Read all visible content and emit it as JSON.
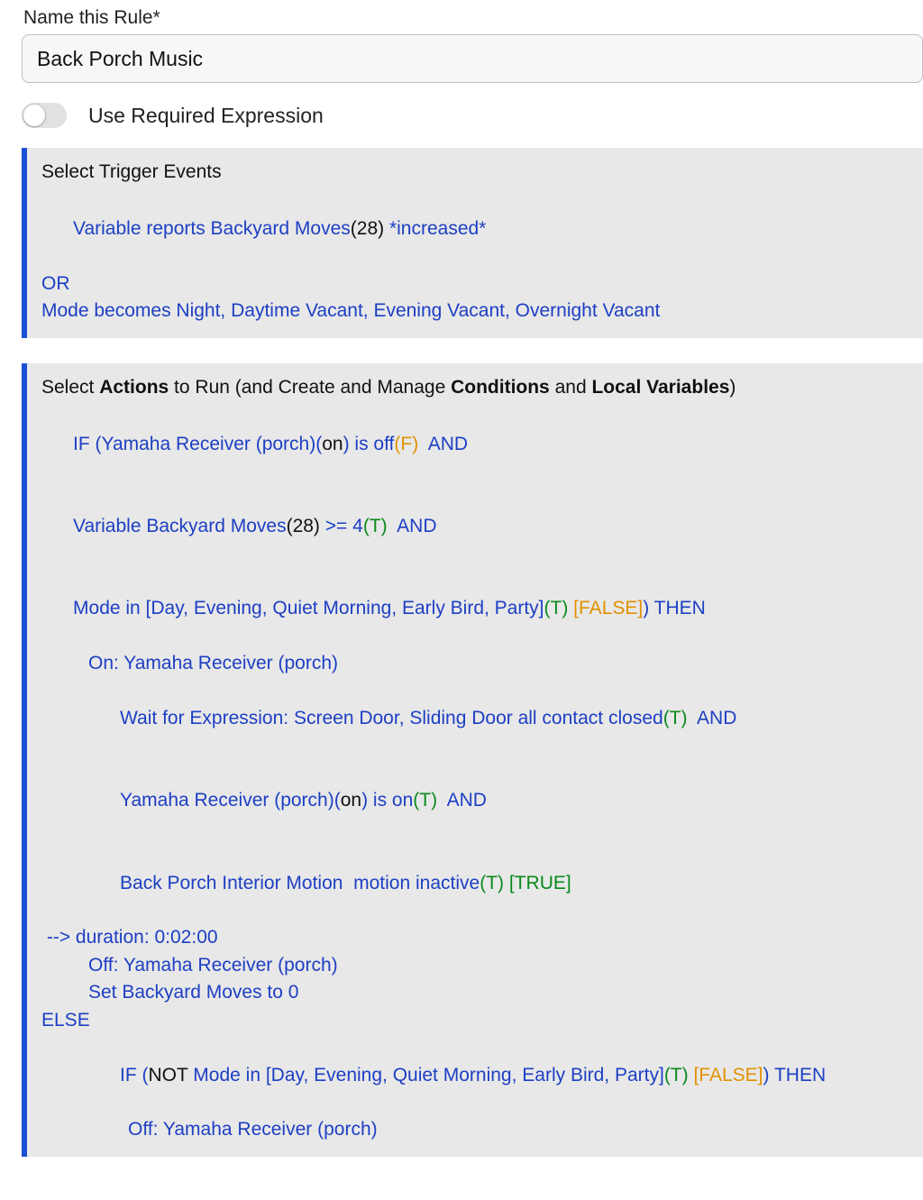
{
  "name_label": "Name this Rule*",
  "name_value": "Back Porch Music",
  "toggle_label": "Use Required Expression",
  "toggle_checked": false,
  "triggers": {
    "title": "Select Trigger Events",
    "line1": {
      "prefix": "Variable reports Backyard Moves",
      "paren": "(28)",
      "suffix": " *increased*"
    },
    "or": "OR",
    "line2": "Mode becomes Night, Daytime Vacant, Evening Vacant, Overnight Vacant"
  },
  "actions": {
    "title_plain1": "Select ",
    "title_bold1": "Actions",
    "title_plain2": " to Run (and Create and Manage ",
    "title_bold2": "Conditions",
    "title_plain3": " and ",
    "title_bold3": "Local Variables",
    "title_plain4": ")",
    "if1": {
      "a": "IF (Yamaha Receiver (porch)(",
      "on": "on",
      "b": ") is off",
      "fp": "(F)",
      "and": "  AND"
    },
    "if2": {
      "a": "Variable Backyard Moves",
      "paren": "(28)",
      "b": " >= 4",
      "tp": "(T)",
      "and": "  AND"
    },
    "if3": {
      "a": "Mode in [Day, Evening, Quiet Morning, Early Bird, Party]",
      "tp": "(T)",
      "false_lbl": " [FALSE]",
      "then": ") THEN"
    },
    "act_on": "On: Yamaha Receiver (porch)",
    "wait": {
      "a": "Wait for Expression: Screen Door, Sliding Door all contact closed",
      "tp": "(T)",
      "and": "  AND"
    },
    "yr_on": {
      "a": "Yamaha Receiver (porch)(",
      "on": "on",
      "b": ") is on",
      "tp": "(T)",
      "and": "  AND"
    },
    "motion": {
      "a": "Back Porch Interior Motion  motion inactive",
      "tp": "(T)",
      "true_lbl": " [TRUE]"
    },
    "duration": " --> duration: 0:02:00",
    "act_off": "Off: Yamaha Receiver (porch)",
    "setvar": "Set Backyard Moves to 0",
    "else": "ELSE",
    "nested_if": {
      "a": "IF (",
      "not": "NOT",
      "b": " Mode in [Day, Evening, Quiet Morning, Early Bird, Party]",
      "tp": "(T)",
      "false_lbl": " [FALSE]",
      "then": ") THEN"
    },
    "nested_off": "Off: Yamaha Receiver (porch)"
  }
}
